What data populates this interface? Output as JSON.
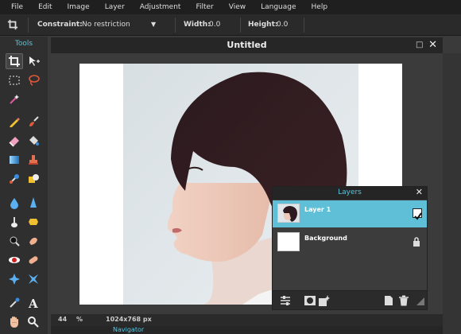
{
  "menu": [
    "File",
    "Edit",
    "Image",
    "Layer",
    "Adjustment",
    "Filter",
    "View",
    "Language",
    "Help"
  ],
  "options": {
    "constraint_label": "Constraint:",
    "constraint_value": "No restriction",
    "width_label": "Width:",
    "width_value": "0.0",
    "height_label": "Height:",
    "height_value": "0.0"
  },
  "tools_title": "Tools",
  "document": {
    "title": "Untitled",
    "zoom": "44",
    "zoom_unit": "%",
    "size": "1024x768 px"
  },
  "navigator_label": "Navigator",
  "layers": {
    "title": "Layers",
    "items": [
      {
        "name": "Layer 1",
        "selected": true,
        "visible": true
      },
      {
        "name": "Background",
        "selected": false,
        "locked": true
      }
    ]
  },
  "colors": {
    "accent": "#56c6e0",
    "selection": "#5fbfd6"
  }
}
